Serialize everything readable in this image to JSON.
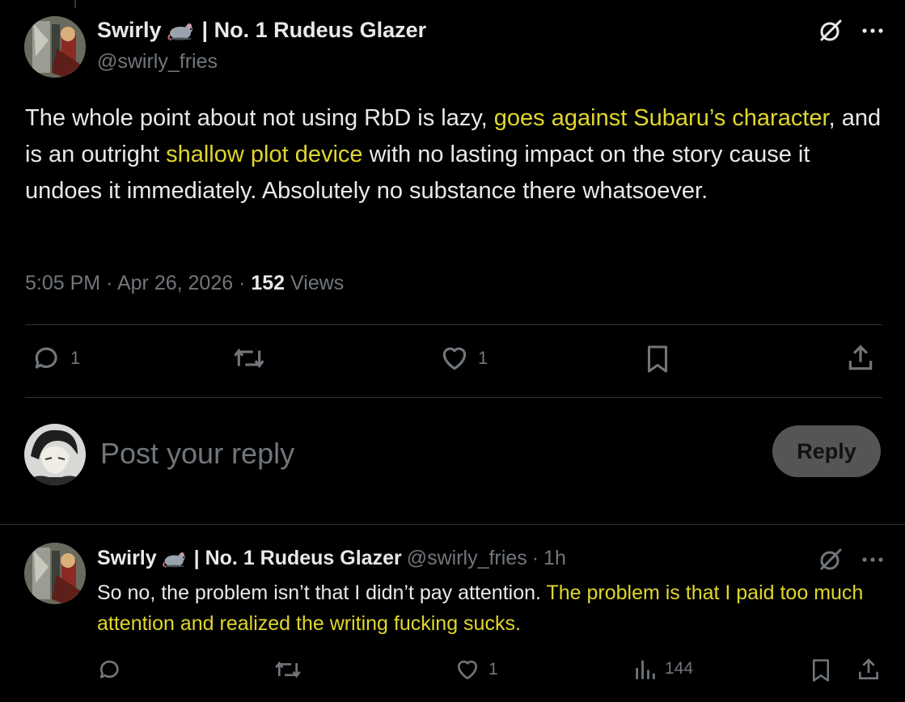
{
  "main_post": {
    "author_name": "Swirly",
    "author_title": "| No. 1 Rudeus Glazer",
    "handle": "@swirly_fries",
    "text_segments": [
      {
        "text": "The whole point about not using RbD is lazy, ",
        "highlight": false
      },
      {
        "text": "goes against Subaru’s character",
        "highlight": true
      },
      {
        "text": ", and is an outright ",
        "highlight": false
      },
      {
        "text": "shallow plot device",
        "highlight": true
      },
      {
        "text": " with no lasting impact on the story cause it undoes it immediately. Absolutely no substance there whatsoever.",
        "highlight": false
      }
    ],
    "time": "5:05 PM",
    "date": "Apr 26, 2026",
    "separator": "·",
    "views_count": "152",
    "views_label": "Views",
    "actions": {
      "reply_count": "1",
      "retweet_count": "",
      "like_count": "1"
    }
  },
  "composer": {
    "placeholder": "Post your reply",
    "reply_button": "Reply"
  },
  "reply_post": {
    "author_name": "Swirly",
    "author_title": "| No. 1 Rudeus Glazer",
    "handle": "@swirly_fries",
    "separator": "·",
    "time_ago": "1h",
    "text_plain": "So no, the problem isn’t that I didn’t pay attention. ",
    "text_highlight": "The problem is that I paid too much attention and realized the writing fucking sucks.",
    "actions": {
      "like_count": "1",
      "views_count": "144"
    }
  },
  "colors": {
    "background": "#000000",
    "text_primary": "#e7e9ea",
    "text_secondary": "#71767b",
    "highlight": "#e0d62c",
    "divider": "#2f3336"
  },
  "icons": [
    "grok-icon",
    "more-icon",
    "reply-icon",
    "retweet-icon",
    "like-icon",
    "bookmark-icon",
    "share-icon",
    "views-icon",
    "mouse-emoji-icon"
  ]
}
